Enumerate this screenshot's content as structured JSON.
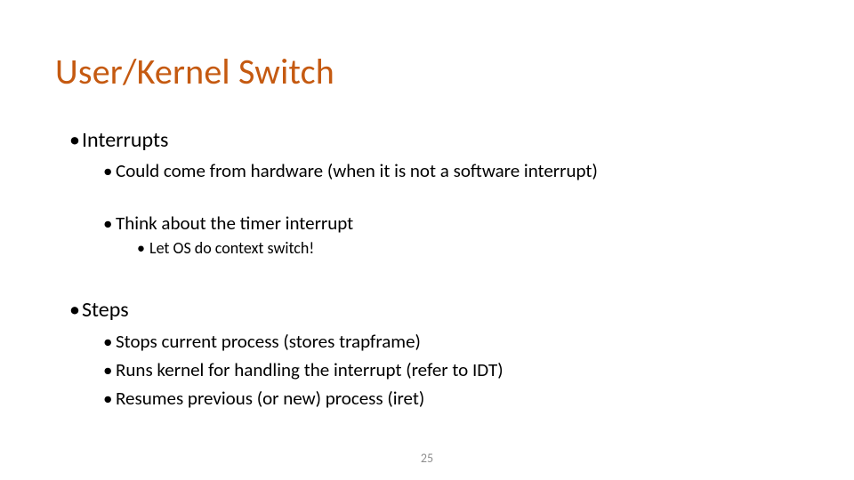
{
  "title": "User/Kernel Switch",
  "bullets": {
    "interrupts_label": "Interrupts",
    "interrupts_sub1": "Could come from hardware (when it is not a software interrupt)",
    "interrupts_sub2": "Think about the timer interrupt",
    "interrupts_sub2_sub1": "Let OS do context switch!",
    "steps_label": "Steps",
    "steps_sub1": "Stops current process (stores trapframe)",
    "steps_sub2": "Runs kernel for handling the interrupt (refer to IDT)",
    "steps_sub3": "Resumes previous (or new) process (iret)"
  },
  "page_number": "25",
  "glyphs": {
    "bullet": "•"
  }
}
